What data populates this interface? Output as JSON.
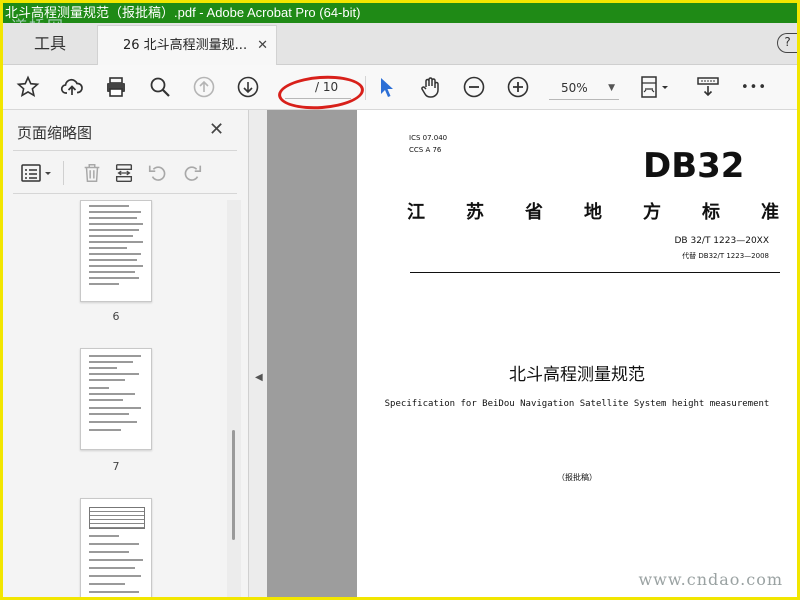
{
  "window": {
    "title": "北斗高程测量规范（报批稿）.pdf - Adobe Acrobat Pro (64-bit)"
  },
  "watermarks": {
    "top_left": "道桥网",
    "bottom_right": "www.cndao.com"
  },
  "tabs": {
    "tools_label": "工具",
    "document_label": "26 北斗高程测量规...",
    "close_glyph": "✕",
    "help_glyph": "?"
  },
  "toolbar": {
    "icons": [
      "star-icon",
      "upload-cloud-icon",
      "print-icon",
      "search-icon",
      "page-up-icon",
      "page-down-icon",
      "select-arrow-icon",
      "hand-icon",
      "zoom-out-icon",
      "zoom-in-icon",
      "page-fit-icon",
      "scroll-mode-icon",
      "more-icon"
    ],
    "page_total": "/ 10",
    "zoom_value": "50%",
    "more_glyph": "•••",
    "colors": {
      "accent": "#2c6fd6",
      "annotation": "#d8201a"
    }
  },
  "sidebar": {
    "title": "页面缩略图",
    "close_glyph": "✕",
    "tool_icons": [
      "thumbnail-options-icon",
      "delete-icon",
      "insert-page-icon",
      "rotate-ccw-icon",
      "rotate-cw-icon"
    ],
    "thumbnails": [
      {
        "page_label": "6"
      },
      {
        "page_label": "7"
      },
      {
        "page_label": ""
      }
    ]
  },
  "document": {
    "ics_line": "ICS  07.040",
    "ccs_line": "CCS  A 76",
    "logo": "DB32",
    "province_chars": [
      "江",
      "苏",
      "省",
      "地",
      "方",
      "标",
      "准"
    ],
    "standard_number": "DB 32/T 1223—20XX",
    "replaces": "代替 DB32/T 1223—2008",
    "title_cn": "北斗高程测量规范",
    "title_en": "Specification for BeiDou Navigation Satellite System height measurement",
    "draft_note": "（报批稿）"
  }
}
